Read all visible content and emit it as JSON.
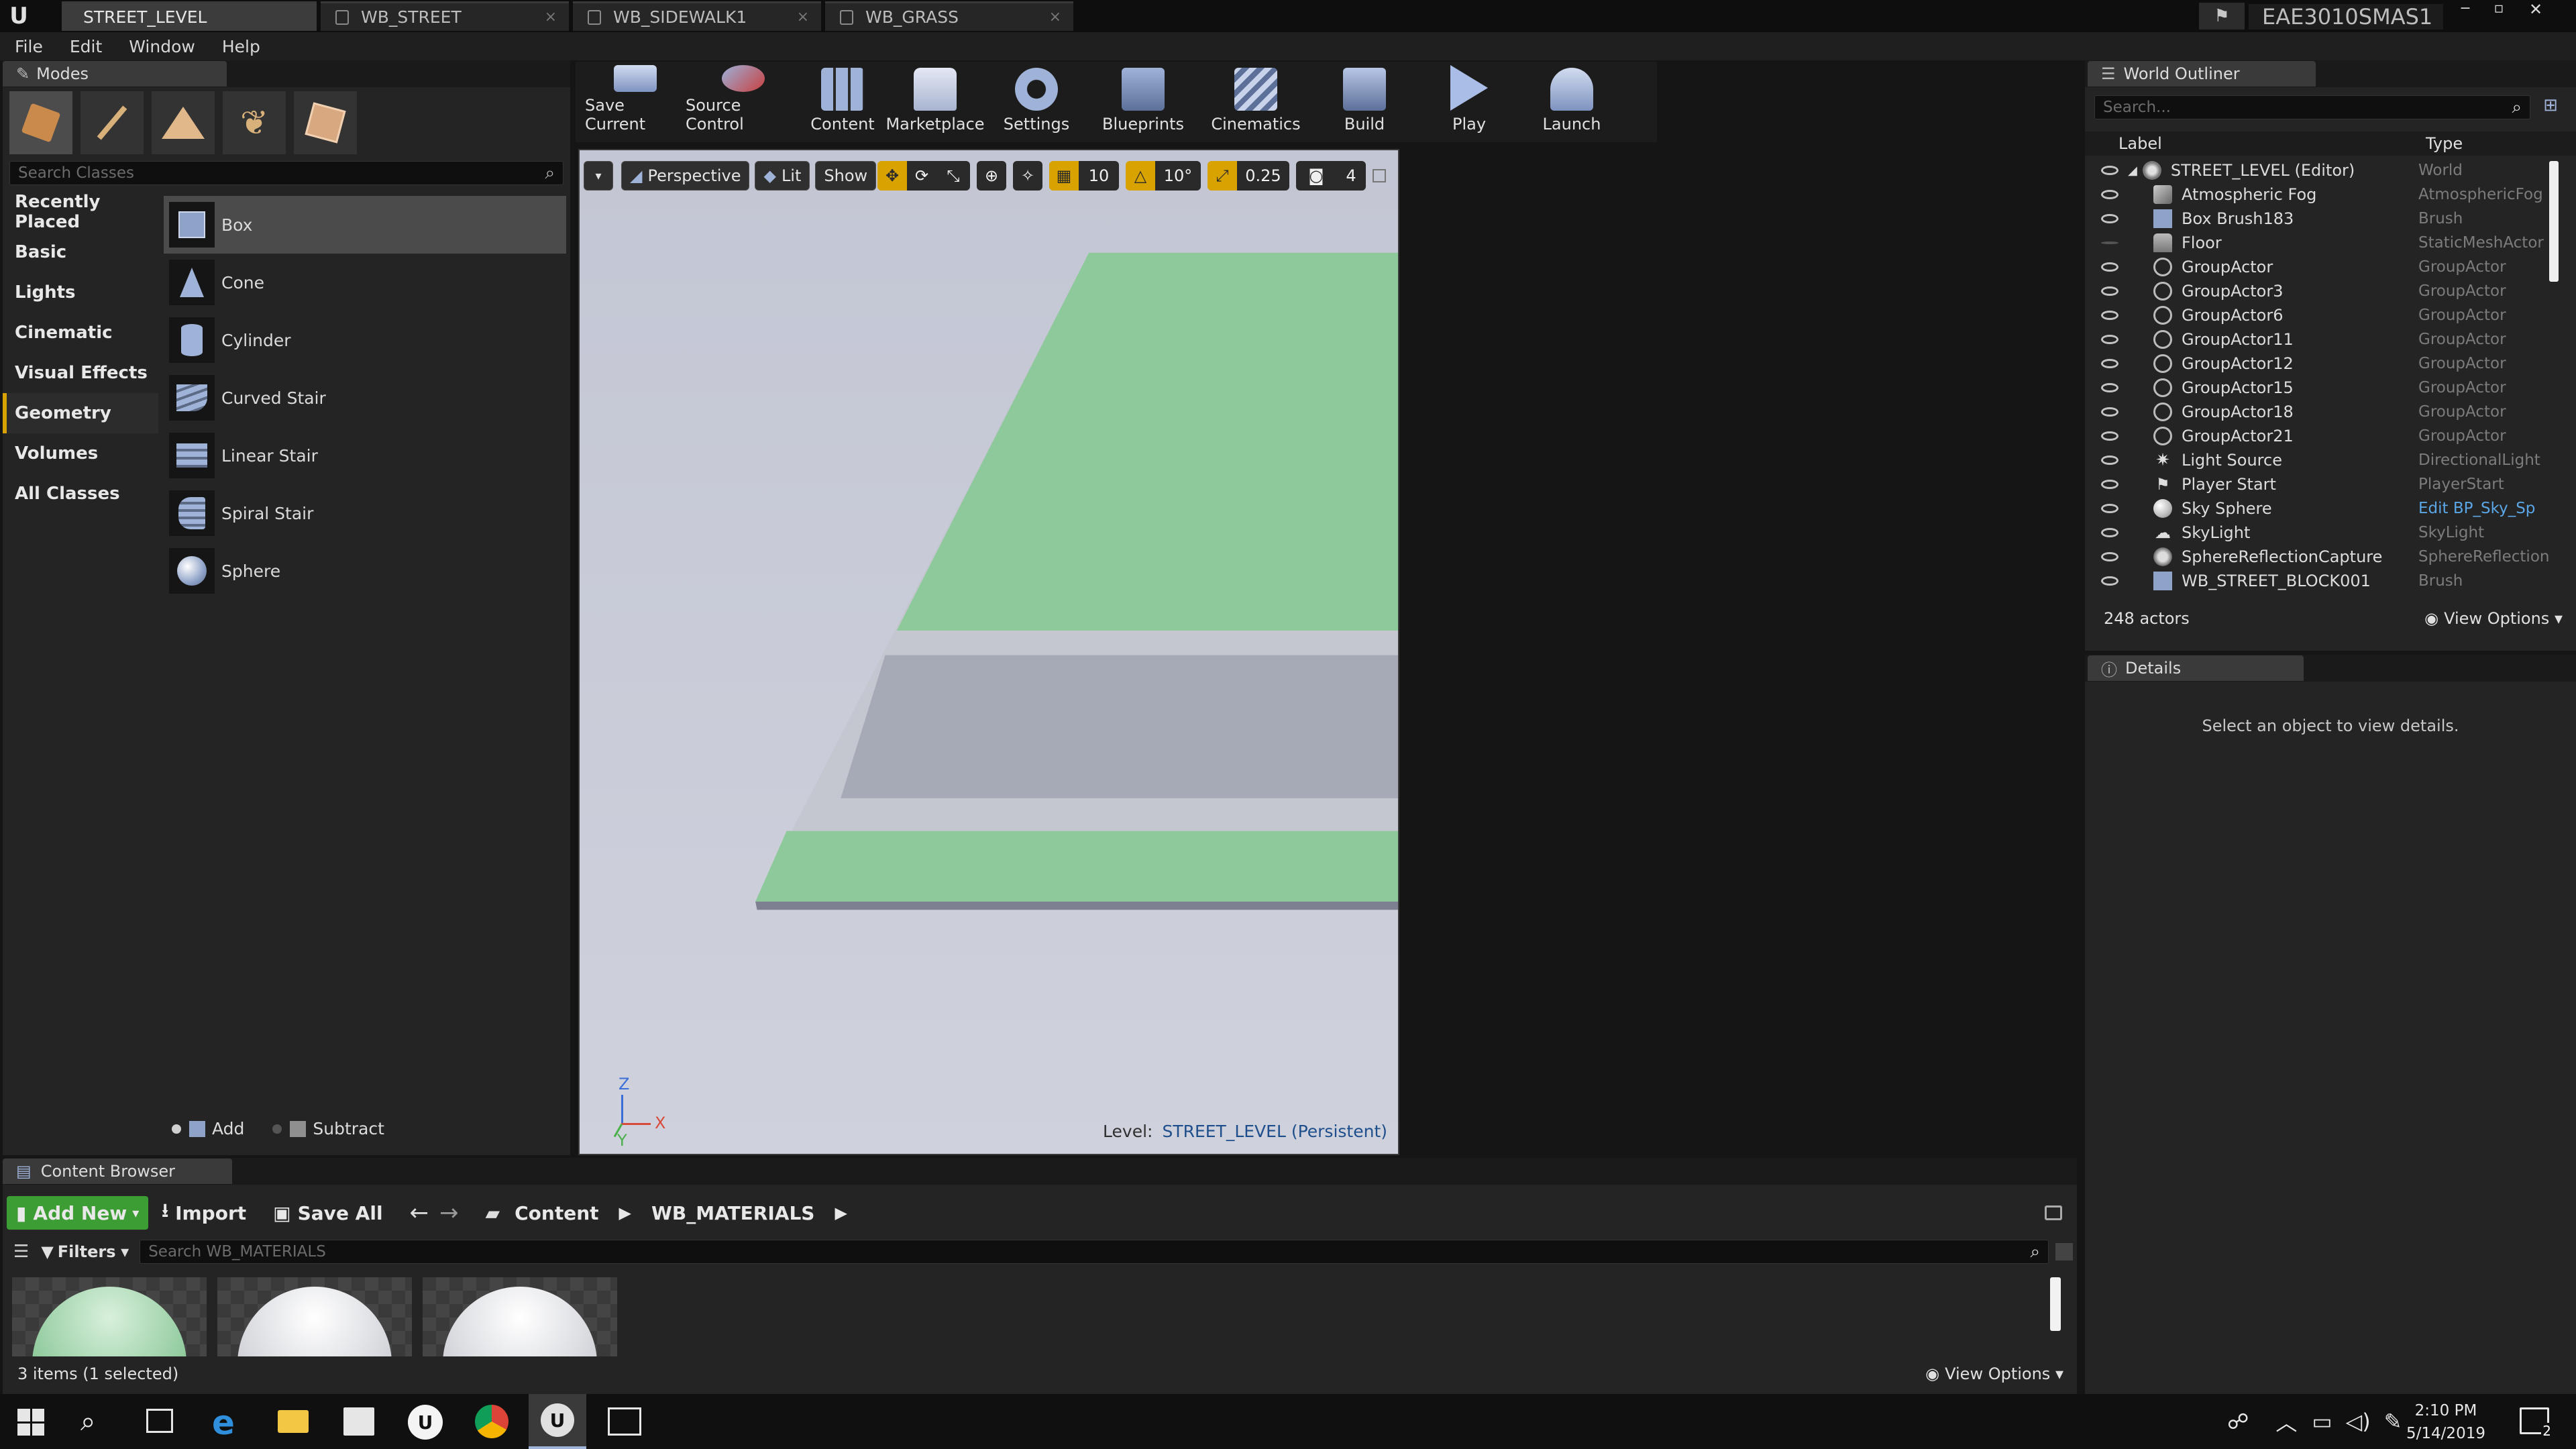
{
  "window": {
    "tabs": [
      {
        "label": "STREET_LEVEL"
      },
      {
        "label": "WB_STREET"
      },
      {
        "label": "WB_SIDEWALK1"
      },
      {
        "label": "WB_GRASS"
      }
    ],
    "project_name": "EAE3010SMAS1"
  },
  "menu": [
    "File",
    "Edit",
    "Window",
    "Help"
  ],
  "modes": {
    "tab_label": "Modes",
    "search_placeholder": "Search Classes",
    "categories": [
      "Recently Placed",
      "Basic",
      "Lights",
      "Cinematic",
      "Visual Effects",
      "Geometry",
      "Volumes",
      "All Classes"
    ],
    "selected_category": "Geometry",
    "items": [
      "Box",
      "Cone",
      "Cylinder",
      "Curved Stair",
      "Linear Stair",
      "Spiral Stair",
      "Sphere"
    ],
    "selected_item": "Box",
    "brush_add": "Add",
    "brush_subtract": "Subtract"
  },
  "toolbar": {
    "buttons": [
      "Save Current",
      "Source Control",
      "Content",
      "Marketplace",
      "Settings",
      "Blueprints",
      "Cinematics",
      "Build",
      "Play",
      "Launch"
    ]
  },
  "viewport": {
    "perspective_label": "Perspective",
    "lit_label": "Lit",
    "show_label": "Show",
    "grid_snap": "10",
    "rotation_snap": "10°",
    "scale_snap": "0.25",
    "camera_speed": "4",
    "level_prefix": "Level:",
    "level_name": "STREET_LEVEL (Persistent)",
    "axis_x": "X",
    "axis_y": "Y",
    "axis_z": "Z"
  },
  "outliner": {
    "tab_label": "World Outliner",
    "search_placeholder": "Search...",
    "col_label": "Label",
    "col_type": "Type",
    "rows": [
      {
        "label": "STREET_LEVEL (Editor)",
        "type": "World"
      },
      {
        "label": "Atmospheric Fog",
        "type": "AtmosphericFog"
      },
      {
        "label": "Box Brush183",
        "type": "Brush"
      },
      {
        "label": "Floor",
        "type": "StaticMeshActor"
      },
      {
        "label": "GroupActor",
        "type": "GroupActor"
      },
      {
        "label": "GroupActor3",
        "type": "GroupActor"
      },
      {
        "label": "GroupActor6",
        "type": "GroupActor"
      },
      {
        "label": "GroupActor11",
        "type": "GroupActor"
      },
      {
        "label": "GroupActor12",
        "type": "GroupActor"
      },
      {
        "label": "GroupActor15",
        "type": "GroupActor"
      },
      {
        "label": "GroupActor18",
        "type": "GroupActor"
      },
      {
        "label": "GroupActor21",
        "type": "GroupActor"
      },
      {
        "label": "Light Source",
        "type": "DirectionalLight"
      },
      {
        "label": "Player Start",
        "type": "PlayerStart"
      },
      {
        "label": "Sky Sphere",
        "type": "Edit BP_Sky_Sp"
      },
      {
        "label": "SkyLight",
        "type": "SkyLight"
      },
      {
        "label": "SphereReflectionCapture",
        "type": "SphereReflection"
      },
      {
        "label": "WB_STREET_BLOCK001",
        "type": "Brush"
      }
    ],
    "actor_count": "248 actors",
    "view_options": "View Options"
  },
  "details": {
    "tab_label": "Details",
    "empty_text": "Select an object to view details."
  },
  "content_browser": {
    "tab_label": "Content Browser",
    "add_new": "Add New",
    "import": "Import",
    "save_all": "Save All",
    "path_root": "Content",
    "path_folder": "WB_MATERIALS",
    "filters": "Filters",
    "search_placeholder": "Search WB_MATERIALS",
    "status": "3 items (1 selected)",
    "view_options": "View Options"
  },
  "taskbar": {
    "time": "2:10 PM",
    "date": "5/14/2019",
    "notifications": "2"
  },
  "colors": {
    "accent": "#d8a200",
    "grass": "#8dc99a",
    "road": "#a3a6b3",
    "sidewalk": "#c4c6d0",
    "sky": "#c7c9d5",
    "add_new_green": "#3c9d34",
    "link_blue": "#5aa6e6"
  }
}
